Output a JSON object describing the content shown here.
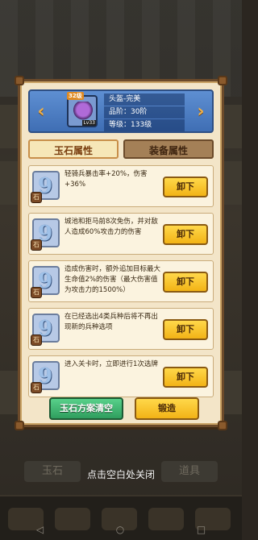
{
  "background": {
    "bottom_left_label": "玉石",
    "bottom_right_label": "道具",
    "nav_buttons": [
      "◁",
      "○",
      "□"
    ]
  },
  "header": {
    "prev_arrow": "‹",
    "next_arrow": "›",
    "item_level_badge": "32级",
    "item_tier_badge": "Lv33",
    "name": "头盔-完美",
    "grade": "品阶：30阶",
    "level": "等级：133级"
  },
  "tabs": [
    {
      "label": "玉石属性",
      "active": true
    },
    {
      "label": "装备属性",
      "active": false
    }
  ],
  "jades": [
    {
      "badge": "石",
      "desc": "轻骑兵暴击率+20%，伤害+36%",
      "button": "卸下"
    },
    {
      "badge": "石",
      "desc": "城池和拒马前8次免伤，并对敌人造成60%攻击力的伤害",
      "button": "卸下"
    },
    {
      "badge": "石",
      "desc": "造成伤害时，额外追加目标最大生命值2%的伤害（最大伤害值为攻击力的1500%）",
      "button": "卸下"
    },
    {
      "badge": "石",
      "desc": "在已经选出4类兵种后将不再出现新的兵种选项",
      "button": "卸下"
    },
    {
      "badge": "石",
      "desc": "进入关卡时，立即进行1次选牌",
      "button": "卸下"
    }
  ],
  "actions": {
    "clear_label": "玉石方案清空",
    "forge_label": "锻造"
  },
  "close_hint": "点击空白处关闭",
  "colors": {
    "panel_bg": "#f3e5c8",
    "header_blue": "#3f6eb4",
    "button_yellow": "#f2b316",
    "button_green": "#2f9e5e"
  }
}
